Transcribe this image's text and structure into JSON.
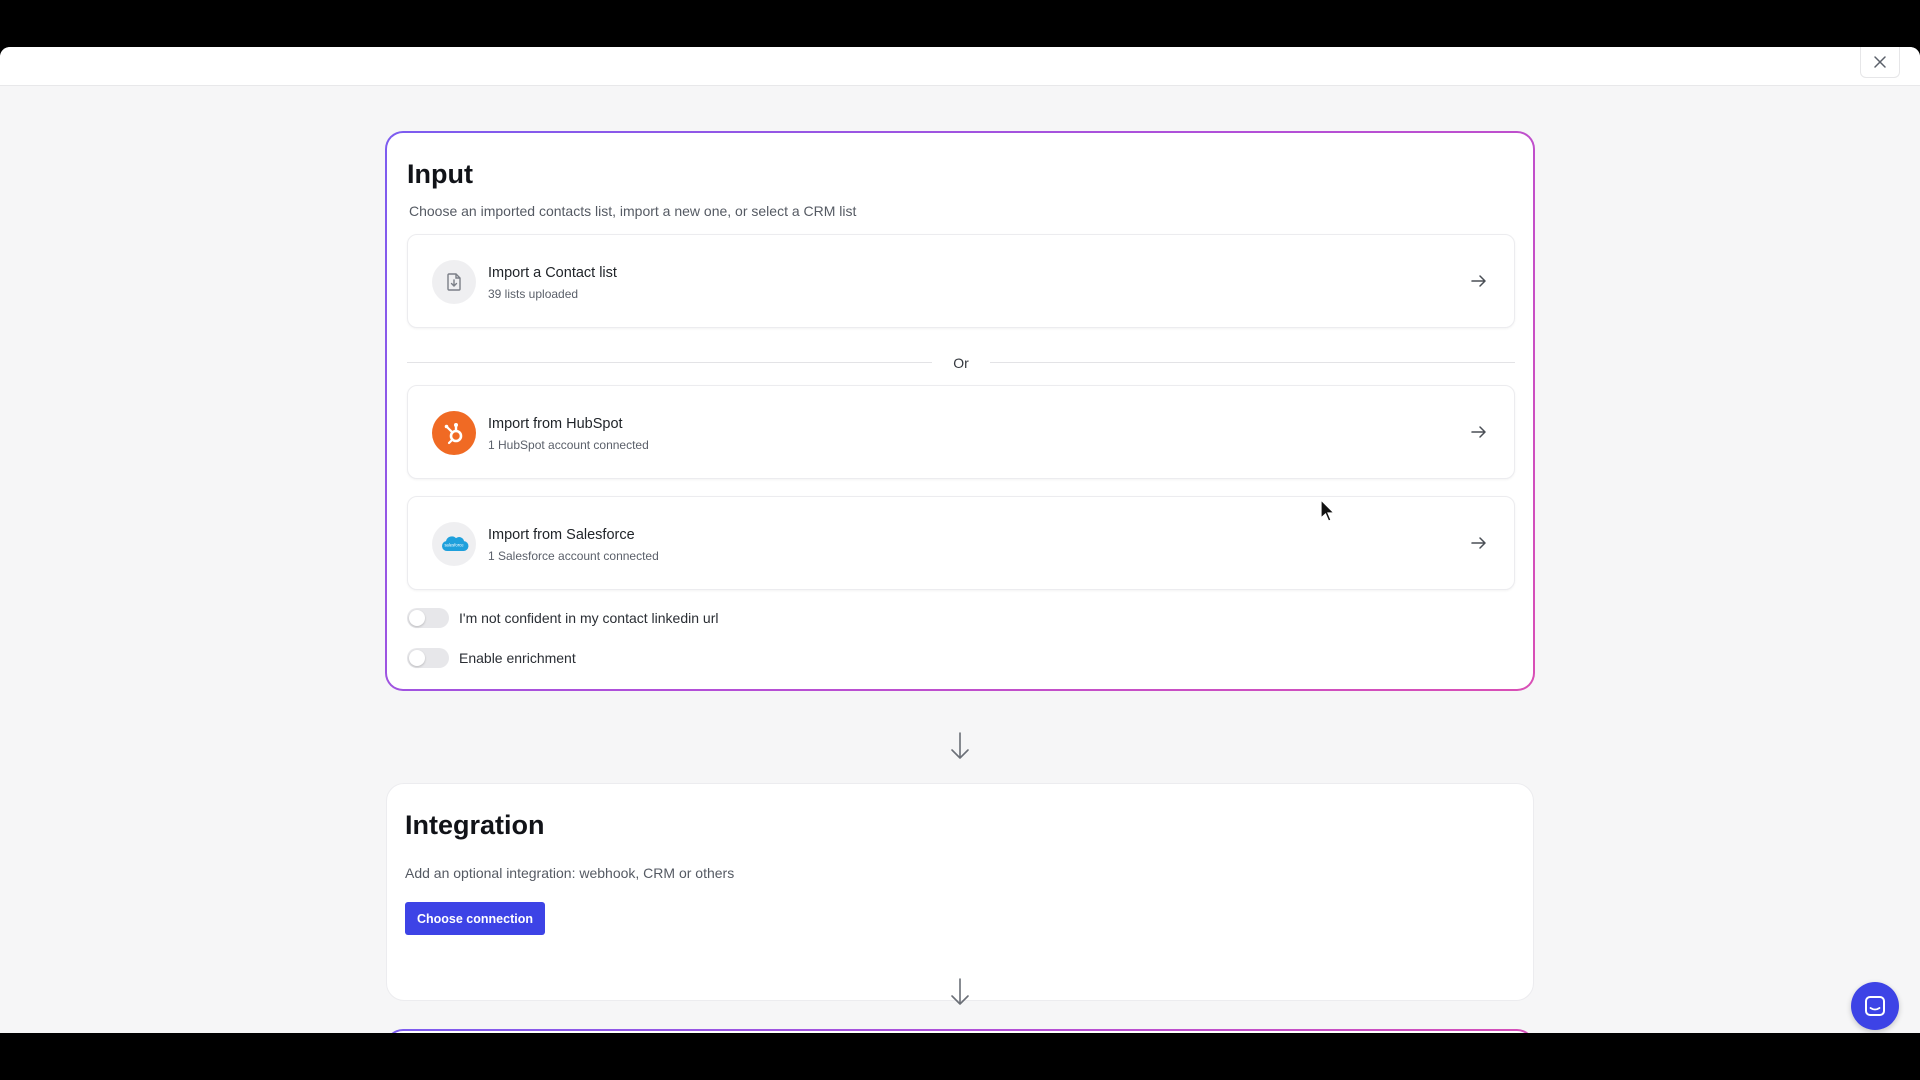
{
  "modal": {
    "close_label": "×"
  },
  "input_section": {
    "title": "Input",
    "subtitle": "Choose an imported contacts list, import a new one, or select a CRM list",
    "options": [
      {
        "title": "Import a Contact list",
        "subtitle": "39 lists uploaded",
        "icon": "file-import-icon"
      },
      {
        "title": "Import from HubSpot",
        "subtitle": "1 HubSpot account connected",
        "icon": "hubspot-logo-icon"
      },
      {
        "title": "Import from Salesforce",
        "subtitle": "1 Salesforce account connected",
        "icon": "salesforce-logo-icon"
      }
    ],
    "divider_label": "Or",
    "toggles": [
      {
        "label": "I'm not confident in my contact linkedin url",
        "on": false
      },
      {
        "label": "Enable enrichment",
        "on": false
      }
    ]
  },
  "integration_section": {
    "title": "Integration",
    "subtitle": "Add an optional integration: webhook, CRM or others",
    "button_label": "Choose connection"
  },
  "colors": {
    "accent": "#3d43e6",
    "hubspot": "#f06a24",
    "salesforce": "#1ea0dc",
    "gradient_start": "#7c5cf0",
    "gradient_end": "#d94fb5"
  }
}
